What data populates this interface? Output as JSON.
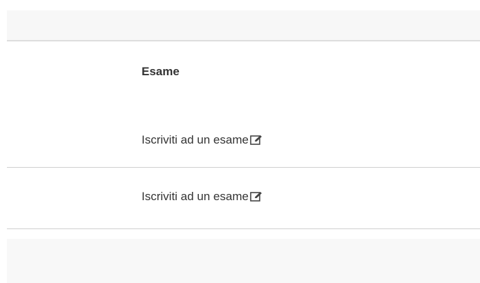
{
  "table": {
    "header": {
      "exam_label": "Esame"
    },
    "rows": [
      {
        "action_label": "Iscriviti ad un esame",
        "icon": "edit-icon"
      },
      {
        "action_label": "Iscriviti ad un esame",
        "icon": "edit-icon"
      }
    ]
  },
  "colors": {
    "text": "#333333",
    "band": "#f7f7f7",
    "rule": "#cfcfcf"
  }
}
